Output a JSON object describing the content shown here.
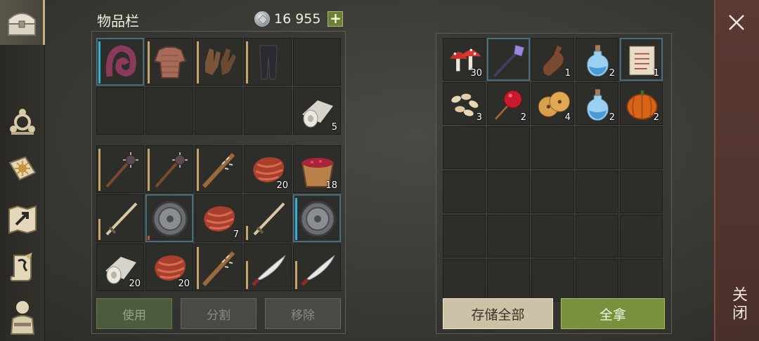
{
  "inventory": {
    "title": "物品栏",
    "currency_amount": "16 955",
    "add_label": "+"
  },
  "equipment_slots": [
    {
      "name": "hood",
      "qty": ""
    },
    {
      "name": "chainmail-shirt",
      "qty": ""
    },
    {
      "name": "leather-gloves",
      "qty": ""
    },
    {
      "name": "leather-pants",
      "qty": ""
    },
    {
      "name": "empty",
      "qty": ""
    },
    {
      "name": "empty",
      "qty": ""
    },
    {
      "name": "empty",
      "qty": ""
    },
    {
      "name": "empty",
      "qty": ""
    },
    {
      "name": "empty",
      "qty": ""
    },
    {
      "name": "cloth-roll",
      "qty": "5"
    }
  ],
  "backpack_slots": [
    {
      "name": "spiked-mace",
      "qty": ""
    },
    {
      "name": "spiked-mace",
      "qty": ""
    },
    {
      "name": "spiked-club",
      "qty": ""
    },
    {
      "name": "raw-meat",
      "qty": "20"
    },
    {
      "name": "berry-bucket",
      "qty": "18"
    },
    {
      "name": "sword",
      "qty": ""
    },
    {
      "name": "round-shield",
      "qty": ""
    },
    {
      "name": "raw-meat",
      "qty": "7"
    },
    {
      "name": "sword",
      "qty": ""
    },
    {
      "name": "round-shield",
      "qty": ""
    },
    {
      "name": "cloth-roll",
      "qty": "20"
    },
    {
      "name": "raw-meat",
      "qty": "20"
    },
    {
      "name": "spiked-club",
      "qty": ""
    },
    {
      "name": "scimitar",
      "qty": ""
    },
    {
      "name": "scimitar",
      "qty": ""
    }
  ],
  "storage_slots": [
    {
      "name": "mushrooms",
      "qty": "30"
    },
    {
      "name": "magic-staff",
      "qty": ""
    },
    {
      "name": "bottle",
      "qty": "1"
    },
    {
      "name": "potion",
      "qty": "2"
    },
    {
      "name": "scroll",
      "qty": "1"
    },
    {
      "name": "seeds",
      "qty": "3"
    },
    {
      "name": "candied-apple",
      "qty": "2"
    },
    {
      "name": "cookies",
      "qty": "4"
    },
    {
      "name": "potion",
      "qty": "2"
    },
    {
      "name": "pumpkin",
      "qty": "2"
    }
  ],
  "buttons": {
    "use": "使用",
    "split": "分割",
    "remove": "移除",
    "store_all": "存储全部",
    "take_all": "全拿",
    "close": "关闭"
  },
  "sidebar_icons": [
    "chest-icon",
    "crafting-icon",
    "skills-book-icon",
    "map-icon",
    "scroll-quest-icon",
    "character-icon"
  ],
  "colors": {
    "take_all_green": "#79913e",
    "store_all_beige": "#cdc2a7",
    "close_red": "#5a3a33",
    "durability_gold": "#c9a46a",
    "quality_blue": "#3ab0d8"
  }
}
